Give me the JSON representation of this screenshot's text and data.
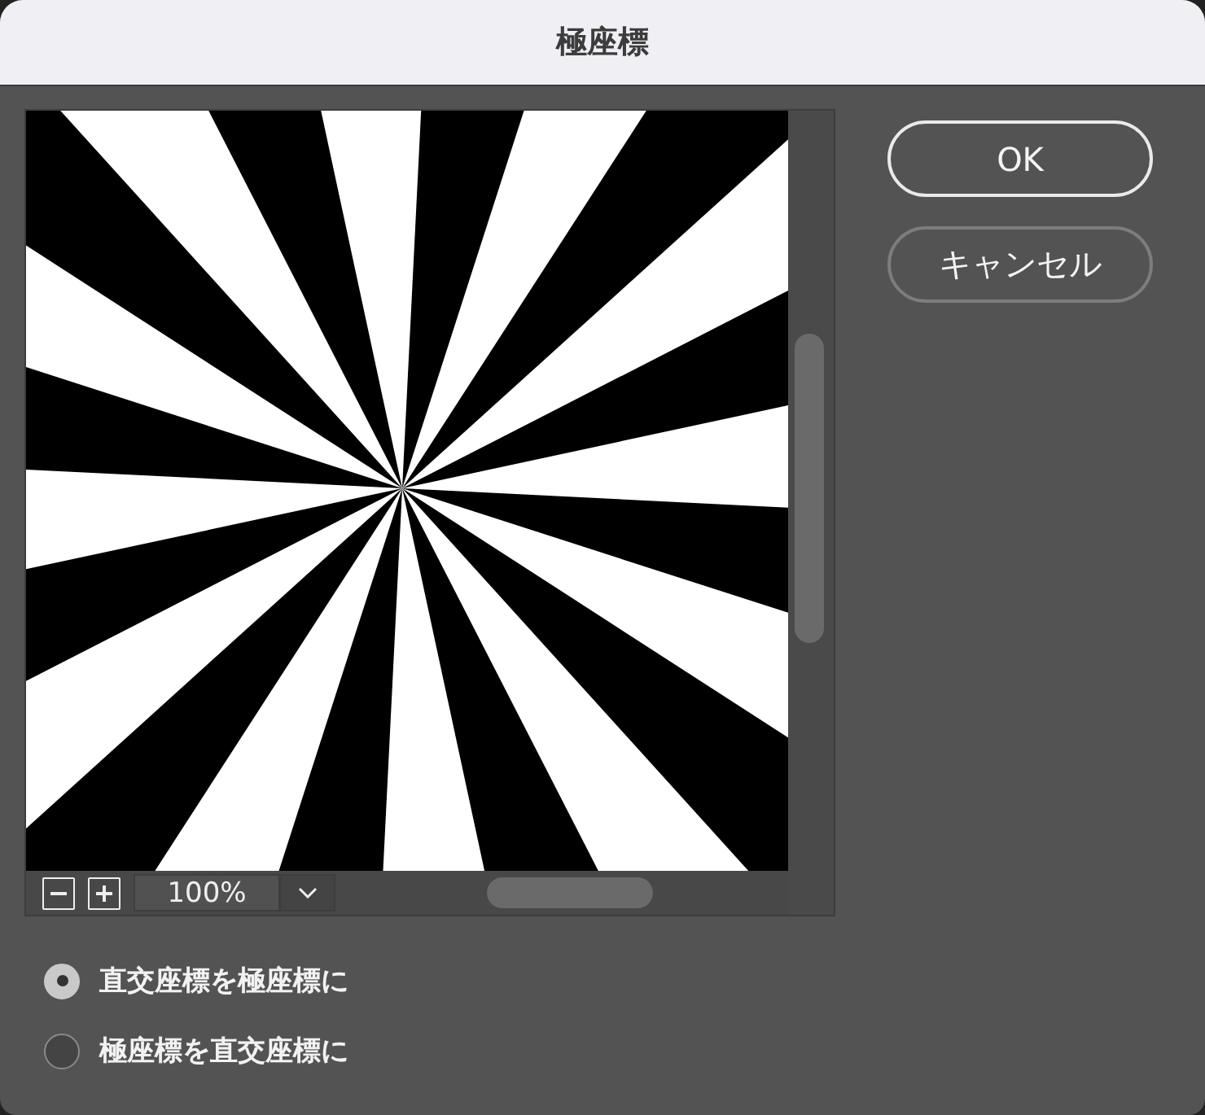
{
  "window": {
    "title": "極座標"
  },
  "preview": {
    "zoom": "100%"
  },
  "options": [
    {
      "label": "直交座標を極座標に",
      "selected": true
    },
    {
      "label": "極座標を直交座標に",
      "selected": false
    }
  ],
  "buttons": [
    {
      "label": "OK",
      "kind": "primary"
    },
    {
      "label": "キャンセル",
      "kind": "secondary"
    }
  ]
}
